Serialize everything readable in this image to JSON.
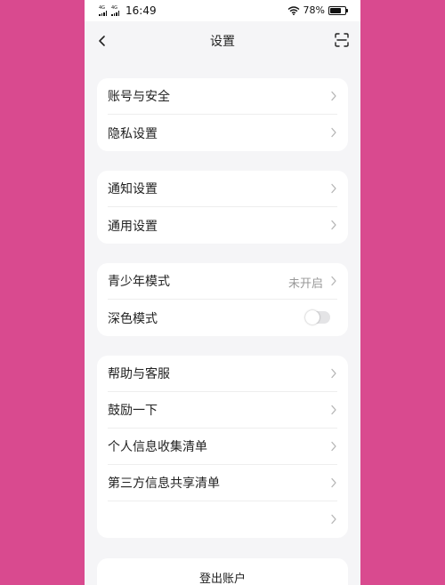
{
  "status_bar": {
    "signal1": "4G",
    "signal2": "4G",
    "time": "16:49",
    "battery": "78%",
    "battery_level": 0.78
  },
  "header": {
    "title": "设置"
  },
  "groups": [
    {
      "items": [
        {
          "label": "账号与安全"
        },
        {
          "label": "隐私设置"
        }
      ]
    },
    {
      "items": [
        {
          "label": "通知设置"
        },
        {
          "label": "通用设置"
        }
      ]
    },
    {
      "items": [
        {
          "label": "青少年模式",
          "value": "未开启"
        },
        {
          "label": "深色模式",
          "toggle": false
        }
      ]
    },
    {
      "items": [
        {
          "label": "帮助与客服"
        },
        {
          "label": "鼓励一下"
        },
        {
          "label": "个人信息收集清单"
        },
        {
          "label": "第三方信息共享清单"
        },
        {
          "label": ""
        }
      ]
    }
  ],
  "footer": {
    "logout_label": "登出账户"
  },
  "icons": [
    "back-icon",
    "scan-icon",
    "chevron-right-icon",
    "wifi-icon",
    "battery-icon",
    "signal-icon"
  ],
  "colors": {
    "background": "#d94a8f",
    "page": "#f5f5f7",
    "card": "#ffffff",
    "secondary_text": "#999999"
  }
}
